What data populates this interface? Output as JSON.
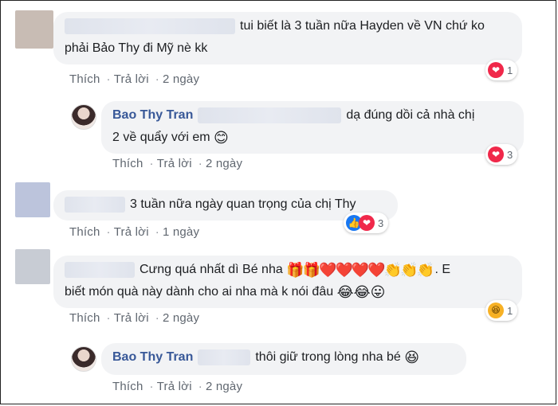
{
  "comments": [
    {
      "text_line1": "tui biết là 3 tuần nữa Hayden về VN chứ ko",
      "text_line2": "phải Bảo Thy đi Mỹ nè kk",
      "actions": {
        "like": "Thích",
        "reply": "Trả lời",
        "time": "2 ngày"
      },
      "reaction_count": "1"
    },
    {
      "author": "Bao Thy Tran",
      "text_line1": "dạ đúng dồi cả nhà chị",
      "text_line2": "2 về quẩy với em",
      "actions": {
        "like": "Thích",
        "reply": "Trả lời",
        "time": "2 ngày"
      },
      "reaction_count": "3"
    },
    {
      "text_line1": "3 tuần nữa ngày quan trọng của chị Thy",
      "actions": {
        "like": "Thích",
        "reply": "Trả lời",
        "time": "1 ngày"
      },
      "reaction_count": "3"
    },
    {
      "text_line1": "Cưng quá nhất dì Bé nha",
      "text_line1_end": ". E",
      "text_line2": "biết món quà này dành cho ai nha mà k nói đâu",
      "actions": {
        "like": "Thích",
        "reply": "Trả lời",
        "time": "2 ngày"
      },
      "reaction_count": "1"
    },
    {
      "author": "Bao Thy Tran",
      "text_line1": "thôi giữ trong lòng nha bé",
      "actions": {
        "like": "Thích",
        "reply": "Trả lời",
        "time": "2 ngày"
      }
    }
  ],
  "emoji": {
    "smile": "😊",
    "gift": "🎁",
    "heart": "❤️",
    "clap": "👏",
    "joy": "😂",
    "tongue": "😛",
    "laugh": "😆",
    "love_icon": "❤",
    "like_icon": "👍"
  }
}
